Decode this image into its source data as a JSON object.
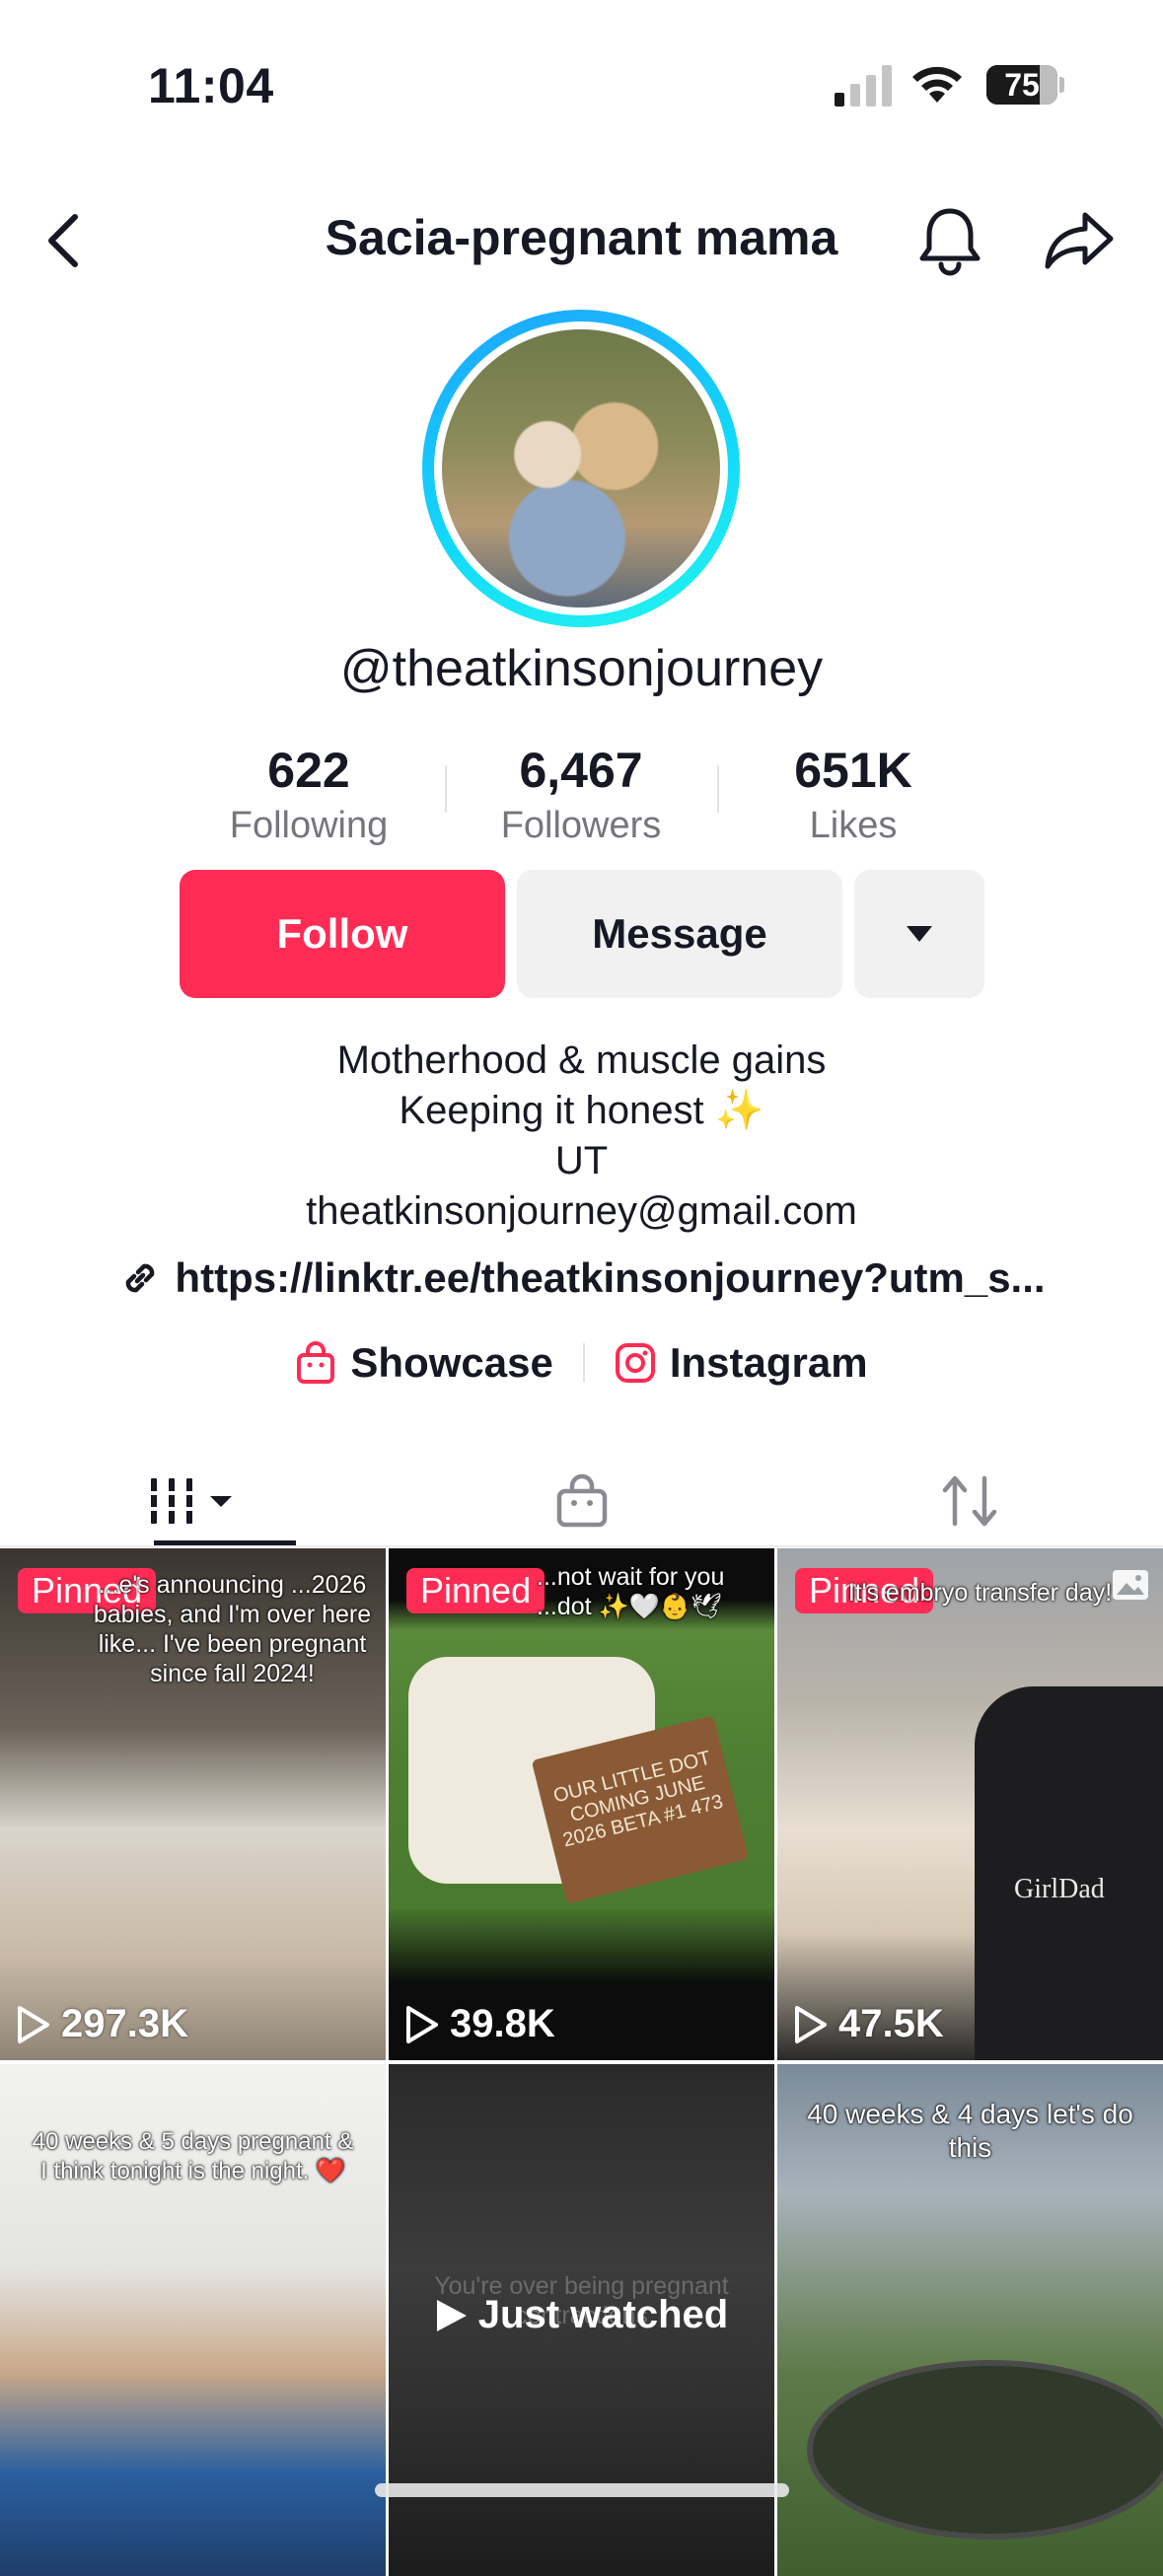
{
  "status_bar": {
    "time": "11:04",
    "battery": "75"
  },
  "header": {
    "title": "Sacia-pregnant mama"
  },
  "profile": {
    "handle": "@theatkinsonjourney",
    "stats": [
      {
        "value": "622",
        "label": "Following"
      },
      {
        "value": "6,467",
        "label": "Followers"
      },
      {
        "value": "651K",
        "label": "Likes"
      }
    ],
    "buttons": {
      "follow": "Follow",
      "message": "Message"
    },
    "bio": {
      "line1": "Motherhood & muscle gains",
      "line2": "Keeping it honest ✨",
      "line3": "UT",
      "line4": "theatkinsonjourney@gmail.com"
    },
    "link": "https://linktr.ee/theatkinsonjourney?utm_s...",
    "social": {
      "showcase": "Showcase",
      "instagram": "Instagram"
    }
  },
  "colors": {
    "accent": "#fe2c55",
    "ring_start": "#1fa2ff",
    "ring_end": "#25f4ee"
  },
  "videos": [
    {
      "pinned": "Pinned",
      "caption": "...e's announcing ...2026 babies, and I'm over here like... I've been pregnant since fall 2024!",
      "views": "297.3K"
    },
    {
      "pinned": "Pinned",
      "caption": "...not wait for you ...dot ✨🤍👶🕊",
      "views": "39.8K",
      "board_text": "OUR LITTLE DOT COMING JUNE 2026 BETA #1 473"
    },
    {
      "pinned": "Pinned",
      "caption": "It's embryo transfer day!",
      "views": "47.5K",
      "shirt_text": "GirlDad"
    },
    {
      "caption": "40 weeks & 5 days pregnant & I think tonight is the night. ❤️"
    },
    {
      "caption": "You're over being pregnant contractions",
      "watched": "Just watched"
    },
    {
      "caption": "40 weeks & 4 days let's do this"
    }
  ]
}
